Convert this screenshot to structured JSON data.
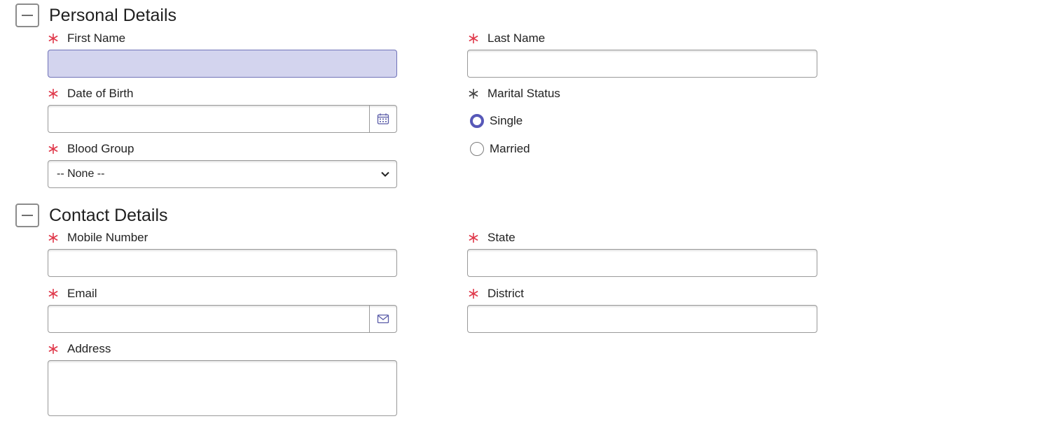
{
  "sections": {
    "personal": {
      "title": "Personal Details",
      "first_name": {
        "label": "First Name",
        "value": ""
      },
      "last_name": {
        "label": "Last Name",
        "value": ""
      },
      "dob": {
        "label": "Date of Birth",
        "value": ""
      },
      "marital": {
        "label": "Marital Status",
        "options": [
          "Single",
          "Married"
        ],
        "selected": "Single"
      },
      "blood_group": {
        "label": "Blood Group",
        "selected": "-- None --"
      }
    },
    "contact": {
      "title": "Contact Details",
      "mobile": {
        "label": "Mobile Number",
        "value": ""
      },
      "state": {
        "label": "State",
        "value": ""
      },
      "email": {
        "label": "Email",
        "value": ""
      },
      "district": {
        "label": "District",
        "value": ""
      },
      "address": {
        "label": "Address",
        "value": ""
      }
    }
  },
  "icons": {
    "section_toggle": "minus-icon",
    "required": "asterisk-icon",
    "calendar": "calendar-icon",
    "email": "envelope-icon",
    "dropdown": "chevron-down-icon"
  },
  "colors": {
    "required_asterisk": "#e0394b",
    "optional_asterisk": "#444444",
    "focused_field_bg": "#d3d4ee",
    "radio_accent": "#5758b8"
  }
}
